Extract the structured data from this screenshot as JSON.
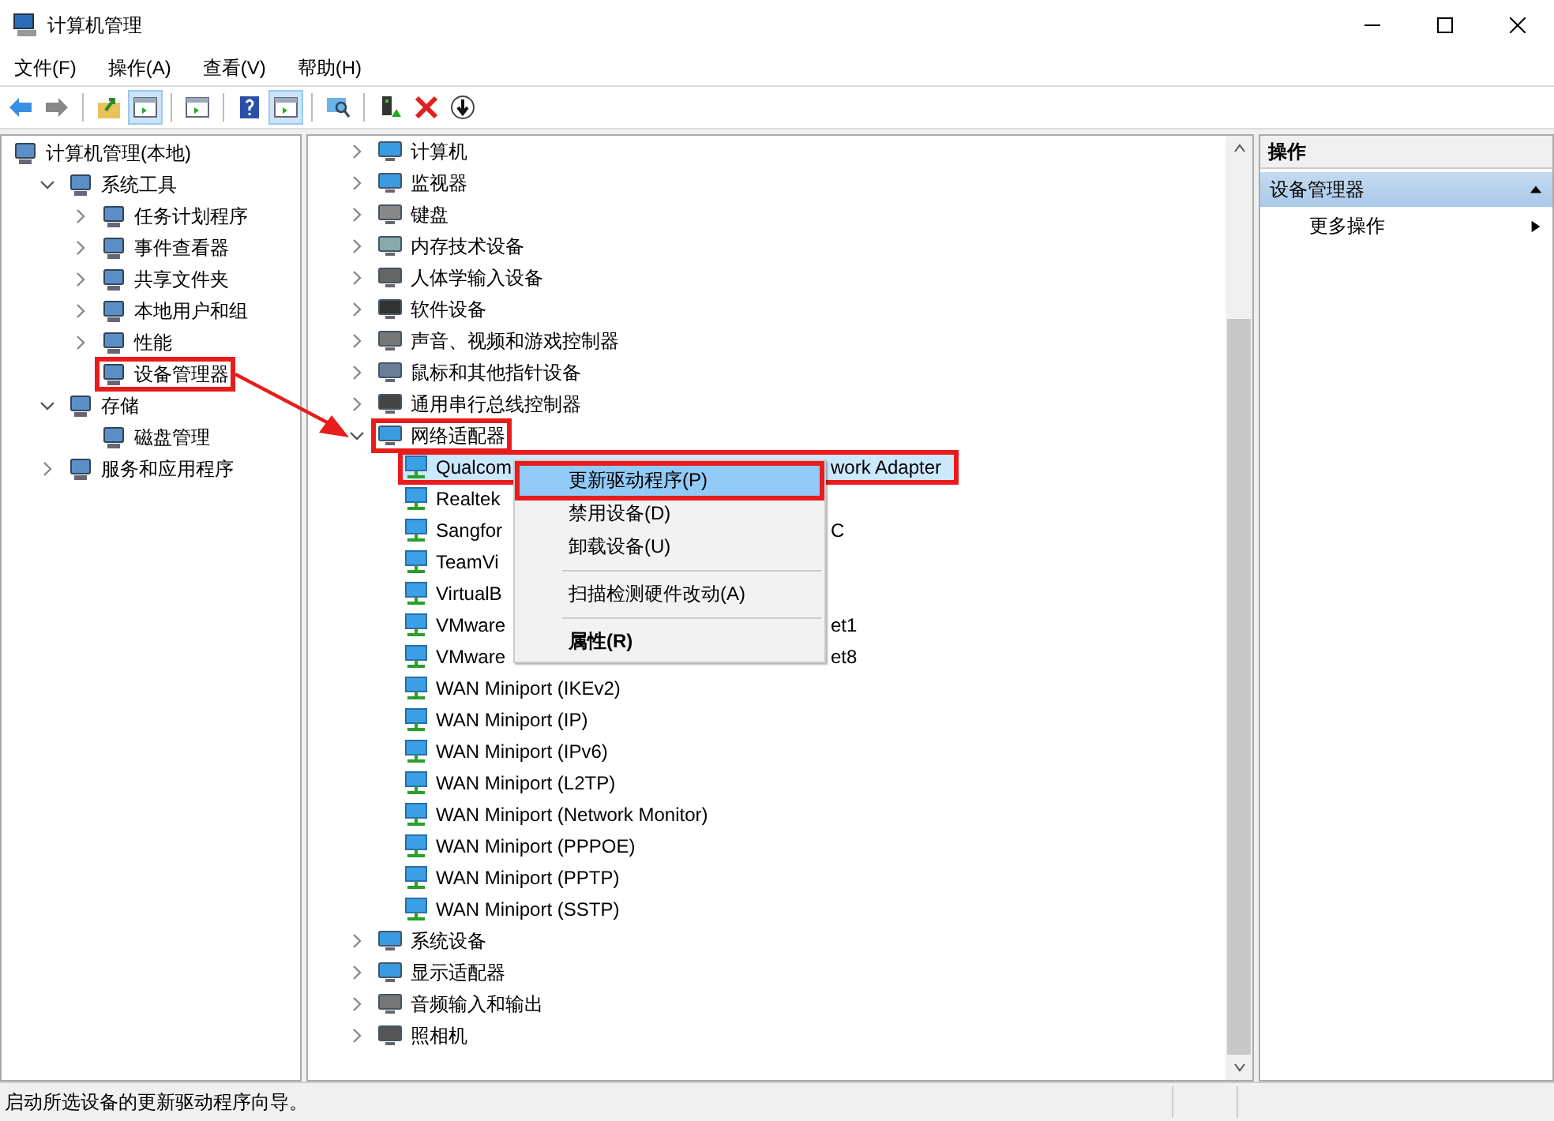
{
  "window": {
    "title": "计算机管理"
  },
  "menu_bar": [
    "文件(F)",
    "操作(A)",
    "查看(V)",
    "帮助(H)"
  ],
  "toolbar": [
    {
      "kind": "button",
      "pressed": false
    },
    {
      "kind": "button",
      "pressed": false
    },
    {
      "kind": "separator"
    },
    {
      "kind": "button",
      "pressed": false
    },
    {
      "kind": "button",
      "pressed": true
    },
    {
      "kind": "separator"
    },
    {
      "kind": "button",
      "pressed": false
    },
    {
      "kind": "separator"
    },
    {
      "kind": "button",
      "pressed": false
    },
    {
      "kind": "button",
      "pressed": true
    },
    {
      "kind": "separator"
    },
    {
      "kind": "button",
      "pressed": false
    },
    {
      "kind": "separator"
    },
    {
      "kind": "button",
      "pressed": false
    },
    {
      "kind": "button",
      "pressed": false
    },
    {
      "kind": "button",
      "pressed": false
    }
  ],
  "navigation_tree": [
    {
      "label": "计算机管理(本地)",
      "annotated": false,
      "children": [
        {
          "label": "系统工具",
          "expanded": true,
          "annotated": false,
          "children": [
            {
              "label": "任务计划程序",
              "expanded": false,
              "annotated": false
            },
            {
              "label": "事件查看器",
              "expanded": false,
              "annotated": false
            },
            {
              "label": "共享文件夹",
              "expanded": false,
              "annotated": false
            },
            {
              "label": "本地用户和组",
              "expanded": false,
              "annotated": false
            },
            {
              "label": "性能",
              "expanded": false,
              "annotated": false
            },
            {
              "label": "设备管理器",
              "annotated": true
            }
          ]
        },
        {
          "label": "存储",
          "expanded": true,
          "annotated": false,
          "children": [
            {
              "label": "磁盘管理",
              "annotated": false
            }
          ]
        },
        {
          "label": "服务和应用程序",
          "expanded": false,
          "annotated": false
        }
      ]
    }
  ],
  "device_tree": [
    {
      "label": "计算机",
      "expanded": false,
      "annotated": false
    },
    {
      "label": "监视器",
      "expanded": false,
      "annotated": false
    },
    {
      "label": "键盘",
      "expanded": false,
      "annotated": false
    },
    {
      "label": "内存技术设备",
      "expanded": false,
      "annotated": false
    },
    {
      "label": "人体学输入设备",
      "expanded": false,
      "annotated": false
    },
    {
      "label": "软件设备",
      "expanded": false,
      "annotated": false
    },
    {
      "label": "声音、视频和游戏控制器",
      "expanded": false,
      "annotated": false
    },
    {
      "label": "鼠标和其他指针设备",
      "expanded": false,
      "annotated": false
    },
    {
      "label": "通用串行总线控制器",
      "expanded": false,
      "annotated": false
    },
    {
      "label": "网络适配器",
      "expanded": true,
      "annotated": true,
      "children": [
        {
          "label": "Qualcom",
          "tail": "work Adapter",
          "selected": true,
          "annotated": true
        },
        {
          "label": "Realtek",
          "selected": false,
          "annotated": false
        },
        {
          "label": "Sangfor",
          "tail": "C",
          "selected": false,
          "annotated": false
        },
        {
          "label": "TeamVi",
          "selected": false,
          "annotated": false
        },
        {
          "label": "VirtualB",
          "selected": false,
          "annotated": false
        },
        {
          "label": "VMware",
          "tail": "et1",
          "selected": false,
          "annotated": false
        },
        {
          "label": "VMware",
          "tail": "et8",
          "selected": false,
          "annotated": false
        },
        {
          "label": "WAN Miniport (IKEv2)",
          "selected": false,
          "annotated": false
        },
        {
          "label": "WAN Miniport (IP)",
          "selected": false,
          "annotated": false
        },
        {
          "label": "WAN Miniport (IPv6)",
          "selected": false,
          "annotated": false
        },
        {
          "label": "WAN Miniport (L2TP)",
          "selected": false,
          "annotated": false
        },
        {
          "label": "WAN Miniport (Network Monitor)",
          "selected": false,
          "annotated": false
        },
        {
          "label": "WAN Miniport (PPPOE)",
          "selected": false,
          "annotated": false
        },
        {
          "label": "WAN Miniport (PPTP)",
          "selected": false,
          "annotated": false
        },
        {
          "label": "WAN Miniport (SSTP)",
          "selected": false,
          "annotated": false
        }
      ]
    },
    {
      "label": "系统设备",
      "expanded": false,
      "annotated": false
    },
    {
      "label": "显示适配器",
      "expanded": false,
      "annotated": false
    },
    {
      "label": "音频输入和输出",
      "expanded": false,
      "annotated": false
    },
    {
      "label": "照相机",
      "expanded": false,
      "annotated": false
    }
  ],
  "context_menu": [
    {
      "kind": "item",
      "label": "更新驱动程序(P)",
      "selected": true,
      "default": false,
      "annotated": true
    },
    {
      "kind": "item",
      "label": "禁用设备(D)",
      "selected": false,
      "default": false,
      "annotated": false
    },
    {
      "kind": "item",
      "label": "卸载设备(U)",
      "selected": false,
      "default": false,
      "annotated": false
    },
    {
      "kind": "separator"
    },
    {
      "kind": "item",
      "label": "扫描检测硬件改动(A)",
      "selected": false,
      "default": false,
      "annotated": false
    },
    {
      "kind": "separator"
    },
    {
      "kind": "item",
      "label": "属性(R)",
      "selected": false,
      "default": true,
      "annotated": false
    }
  ],
  "actions_pane": {
    "title": "操作",
    "section": {
      "label": "设备管理器",
      "expanded": true
    },
    "items": [
      {
        "label": "更多操作"
      }
    ]
  },
  "annotation_arrow": true,
  "status_bar": "启动所选设备的更新驱动程序向导。"
}
